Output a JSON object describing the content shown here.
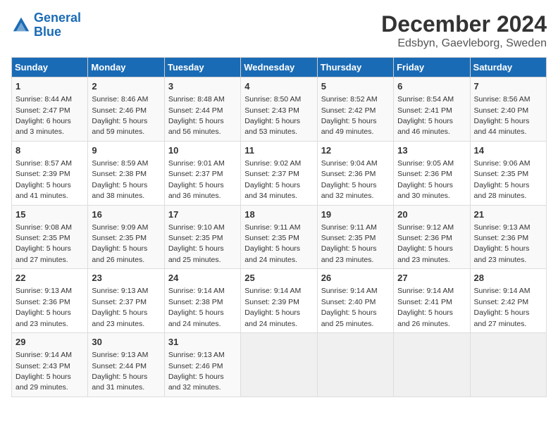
{
  "header": {
    "logo_line1": "General",
    "logo_line2": "Blue",
    "title": "December 2024",
    "subtitle": "Edsbyn, Gaevleborg, Sweden"
  },
  "columns": [
    "Sunday",
    "Monday",
    "Tuesday",
    "Wednesday",
    "Thursday",
    "Friday",
    "Saturday"
  ],
  "weeks": [
    [
      {
        "day": "1",
        "sunrise": "Sunrise: 8:44 AM",
        "sunset": "Sunset: 2:47 PM",
        "daylight": "Daylight: 6 hours and 3 minutes."
      },
      {
        "day": "2",
        "sunrise": "Sunrise: 8:46 AM",
        "sunset": "Sunset: 2:46 PM",
        "daylight": "Daylight: 5 hours and 59 minutes."
      },
      {
        "day": "3",
        "sunrise": "Sunrise: 8:48 AM",
        "sunset": "Sunset: 2:44 PM",
        "daylight": "Daylight: 5 hours and 56 minutes."
      },
      {
        "day": "4",
        "sunrise": "Sunrise: 8:50 AM",
        "sunset": "Sunset: 2:43 PM",
        "daylight": "Daylight: 5 hours and 53 minutes."
      },
      {
        "day": "5",
        "sunrise": "Sunrise: 8:52 AM",
        "sunset": "Sunset: 2:42 PM",
        "daylight": "Daylight: 5 hours and 49 minutes."
      },
      {
        "day": "6",
        "sunrise": "Sunrise: 8:54 AM",
        "sunset": "Sunset: 2:41 PM",
        "daylight": "Daylight: 5 hours and 46 minutes."
      },
      {
        "day": "7",
        "sunrise": "Sunrise: 8:56 AM",
        "sunset": "Sunset: 2:40 PM",
        "daylight": "Daylight: 5 hours and 44 minutes."
      }
    ],
    [
      {
        "day": "8",
        "sunrise": "Sunrise: 8:57 AM",
        "sunset": "Sunset: 2:39 PM",
        "daylight": "Daylight: 5 hours and 41 minutes."
      },
      {
        "day": "9",
        "sunrise": "Sunrise: 8:59 AM",
        "sunset": "Sunset: 2:38 PM",
        "daylight": "Daylight: 5 hours and 38 minutes."
      },
      {
        "day": "10",
        "sunrise": "Sunrise: 9:01 AM",
        "sunset": "Sunset: 2:37 PM",
        "daylight": "Daylight: 5 hours and 36 minutes."
      },
      {
        "day": "11",
        "sunrise": "Sunrise: 9:02 AM",
        "sunset": "Sunset: 2:37 PM",
        "daylight": "Daylight: 5 hours and 34 minutes."
      },
      {
        "day": "12",
        "sunrise": "Sunrise: 9:04 AM",
        "sunset": "Sunset: 2:36 PM",
        "daylight": "Daylight: 5 hours and 32 minutes."
      },
      {
        "day": "13",
        "sunrise": "Sunrise: 9:05 AM",
        "sunset": "Sunset: 2:36 PM",
        "daylight": "Daylight: 5 hours and 30 minutes."
      },
      {
        "day": "14",
        "sunrise": "Sunrise: 9:06 AM",
        "sunset": "Sunset: 2:35 PM",
        "daylight": "Daylight: 5 hours and 28 minutes."
      }
    ],
    [
      {
        "day": "15",
        "sunrise": "Sunrise: 9:08 AM",
        "sunset": "Sunset: 2:35 PM",
        "daylight": "Daylight: 5 hours and 27 minutes."
      },
      {
        "day": "16",
        "sunrise": "Sunrise: 9:09 AM",
        "sunset": "Sunset: 2:35 PM",
        "daylight": "Daylight: 5 hours and 26 minutes."
      },
      {
        "day": "17",
        "sunrise": "Sunrise: 9:10 AM",
        "sunset": "Sunset: 2:35 PM",
        "daylight": "Daylight: 5 hours and 25 minutes."
      },
      {
        "day": "18",
        "sunrise": "Sunrise: 9:11 AM",
        "sunset": "Sunset: 2:35 PM",
        "daylight": "Daylight: 5 hours and 24 minutes."
      },
      {
        "day": "19",
        "sunrise": "Sunrise: 9:11 AM",
        "sunset": "Sunset: 2:35 PM",
        "daylight": "Daylight: 5 hours and 23 minutes."
      },
      {
        "day": "20",
        "sunrise": "Sunrise: 9:12 AM",
        "sunset": "Sunset: 2:36 PM",
        "daylight": "Daylight: 5 hours and 23 minutes."
      },
      {
        "day": "21",
        "sunrise": "Sunrise: 9:13 AM",
        "sunset": "Sunset: 2:36 PM",
        "daylight": "Daylight: 5 hours and 23 minutes."
      }
    ],
    [
      {
        "day": "22",
        "sunrise": "Sunrise: 9:13 AM",
        "sunset": "Sunset: 2:36 PM",
        "daylight": "Daylight: 5 hours and 23 minutes."
      },
      {
        "day": "23",
        "sunrise": "Sunrise: 9:13 AM",
        "sunset": "Sunset: 2:37 PM",
        "daylight": "Daylight: 5 hours and 23 minutes."
      },
      {
        "day": "24",
        "sunrise": "Sunrise: 9:14 AM",
        "sunset": "Sunset: 2:38 PM",
        "daylight": "Daylight: 5 hours and 24 minutes."
      },
      {
        "day": "25",
        "sunrise": "Sunrise: 9:14 AM",
        "sunset": "Sunset: 2:39 PM",
        "daylight": "Daylight: 5 hours and 24 minutes."
      },
      {
        "day": "26",
        "sunrise": "Sunrise: 9:14 AM",
        "sunset": "Sunset: 2:40 PM",
        "daylight": "Daylight: 5 hours and 25 minutes."
      },
      {
        "day": "27",
        "sunrise": "Sunrise: 9:14 AM",
        "sunset": "Sunset: 2:41 PM",
        "daylight": "Daylight: 5 hours and 26 minutes."
      },
      {
        "day": "28",
        "sunrise": "Sunrise: 9:14 AM",
        "sunset": "Sunset: 2:42 PM",
        "daylight": "Daylight: 5 hours and 27 minutes."
      }
    ],
    [
      {
        "day": "29",
        "sunrise": "Sunrise: 9:14 AM",
        "sunset": "Sunset: 2:43 PM",
        "daylight": "Daylight: 5 hours and 29 minutes."
      },
      {
        "day": "30",
        "sunrise": "Sunrise: 9:13 AM",
        "sunset": "Sunset: 2:44 PM",
        "daylight": "Daylight: 5 hours and 31 minutes."
      },
      {
        "day": "31",
        "sunrise": "Sunrise: 9:13 AM",
        "sunset": "Sunset: 2:46 PM",
        "daylight": "Daylight: 5 hours and 32 minutes."
      },
      null,
      null,
      null,
      null
    ]
  ]
}
